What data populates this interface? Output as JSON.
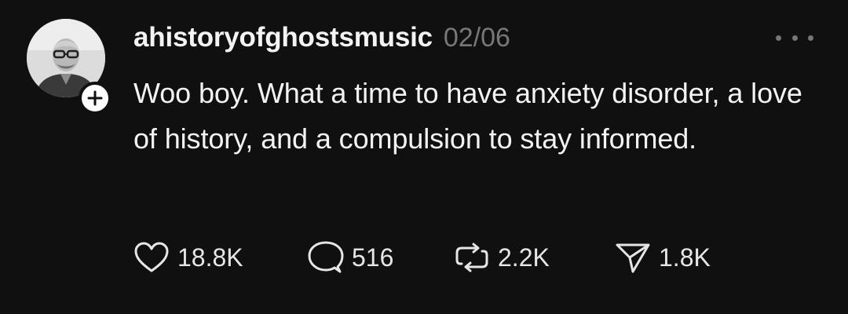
{
  "post": {
    "username": "ahistoryofghostsmusic",
    "timestamp": "02/06",
    "text": "Woo boy. What a time to have anxiety disorder, a love of history, and a compulsion to stay informed.",
    "avatar_icon": "user-photo",
    "follow_icon": "plus-icon"
  },
  "actions": {
    "likes": "18.8K",
    "replies": "516",
    "reposts": "2.2K",
    "shares": "1.8K",
    "like_icon": "heart-icon",
    "reply_icon": "speech-bubble-icon",
    "repost_icon": "repost-icon",
    "share_icon": "send-icon"
  },
  "colors": {
    "background": "#101010",
    "primary_text": "#f3f3f3",
    "secondary_text": "#777777"
  }
}
